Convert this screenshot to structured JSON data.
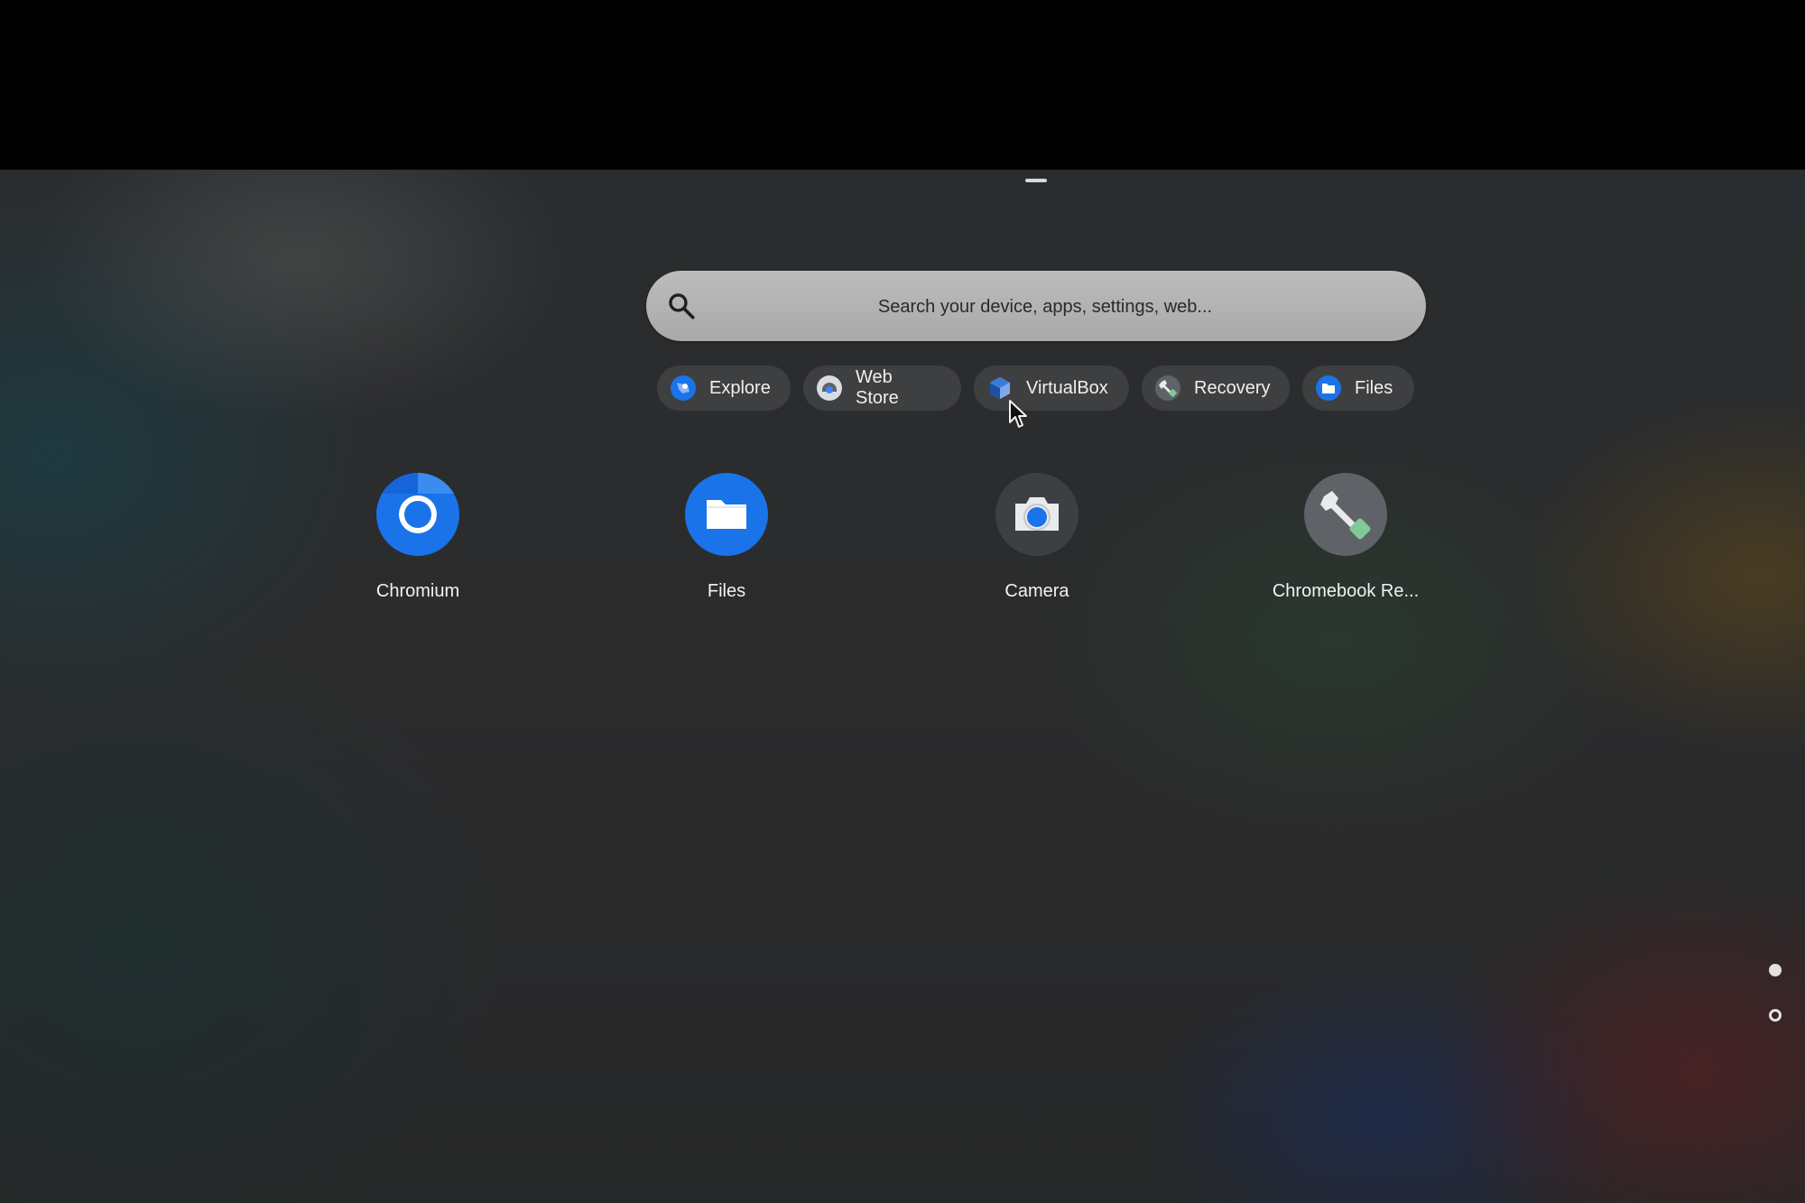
{
  "search": {
    "placeholder": "Search your device, apps, settings, web..."
  },
  "suggestions": [
    {
      "label": "Explore",
      "icon": "explore-icon"
    },
    {
      "label": "Web Store",
      "icon": "web-store-icon"
    },
    {
      "label": "VirtualBox",
      "icon": "virtualbox-icon"
    },
    {
      "label": "Recovery",
      "icon": "recovery-icon"
    },
    {
      "label": "Files",
      "icon": "files-icon"
    }
  ],
  "apps": [
    {
      "label": "Chromium",
      "icon": "chromium-icon"
    },
    {
      "label": "Files",
      "icon": "files-icon"
    },
    {
      "label": "Camera",
      "icon": "camera-icon"
    },
    {
      "label": "Chromebook Re...",
      "icon": "chromebook-recovery-icon"
    }
  ],
  "pages": {
    "count": 2,
    "current": 1
  },
  "colors": {
    "accent_blue": "#1a73e8",
    "recovery_green": "#7fd3a5",
    "search_bar": "#b4b4b4"
  }
}
